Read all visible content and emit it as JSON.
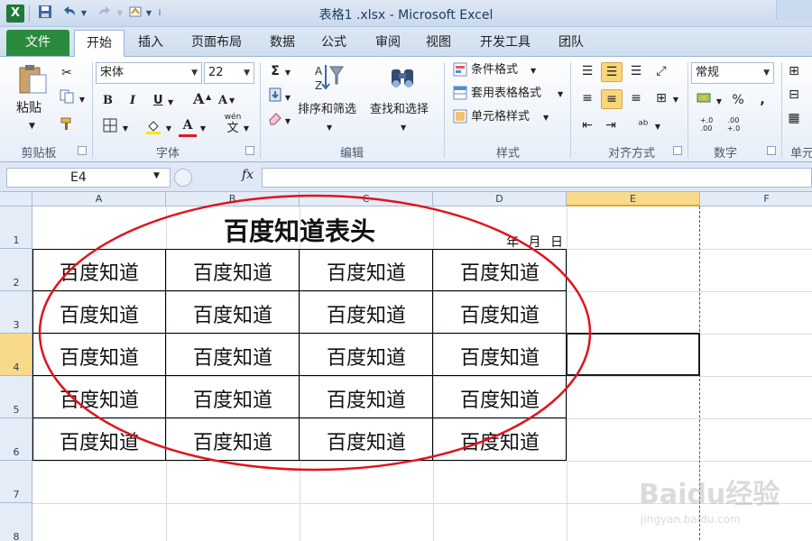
{
  "window": {
    "title": "表格1 .xlsx - Microsoft Excel"
  },
  "quick_access": {
    "app_icon": "X",
    "save_icon": "save-icon",
    "undo_icon": "undo-icon",
    "redo_icon": "redo-icon"
  },
  "ribbon": {
    "file_tab": "文件",
    "tabs": [
      "开始",
      "插入",
      "页面布局",
      "数据",
      "公式",
      "审阅",
      "视图",
      "开发工具",
      "团队"
    ],
    "active_tab": "开始",
    "clipboard": {
      "paste_label": "粘贴",
      "group": "剪贴板"
    },
    "font": {
      "name": "宋体",
      "size": "22",
      "bold": "B",
      "italic": "I",
      "underline": "U",
      "group": "字体",
      "grow": "A",
      "shrink": "A",
      "wen": "wén",
      "wen_char": "文",
      "color_a": "A"
    },
    "editing": {
      "sigma": "Σ",
      "sort_filter": "排序和筛选",
      "find_select": "查找和选择",
      "group": "编辑"
    },
    "styles": {
      "conditional": "条件格式",
      "table_format": "套用表格格式",
      "cell_style": "单元格样式",
      "group": "样式"
    },
    "alignment": {
      "group": "对齐方式"
    },
    "number": {
      "format": "常规",
      "percent": "%",
      "comma": ",",
      "dec_inc": "+.0 .00",
      "dec_dec": ".00 +.0",
      "group": "数字"
    },
    "cells_group": "单元"
  },
  "formula_bar": {
    "name_box": "E4",
    "fx": "fx",
    "content": ""
  },
  "grid": {
    "columns": [
      "A",
      "B",
      "C",
      "D",
      "E",
      "F"
    ],
    "rows": [
      "1",
      "2",
      "3",
      "4",
      "5",
      "6",
      "7",
      "8"
    ],
    "selected_cell": "E4",
    "title": "百度知道表头",
    "date_label": "年 月 日",
    "cells": [
      [
        "百度知道",
        "百度知道",
        "百度知道",
        "百度知道"
      ],
      [
        "百度知道",
        "百度知道",
        "百度知道",
        "百度知道"
      ],
      [
        "百度知道",
        "百度知道",
        "百度知道",
        "百度知道"
      ],
      [
        "百度知道",
        "百度知道",
        "百度知道",
        "百度知道"
      ],
      [
        "百度知道",
        "百度知道",
        "百度知道",
        "百度知道"
      ]
    ]
  },
  "annotation": {
    "ellipse_color": "#e0141e"
  },
  "watermark": {
    "main": "Baidu经验",
    "sub": "jingyan.baidu.com"
  }
}
